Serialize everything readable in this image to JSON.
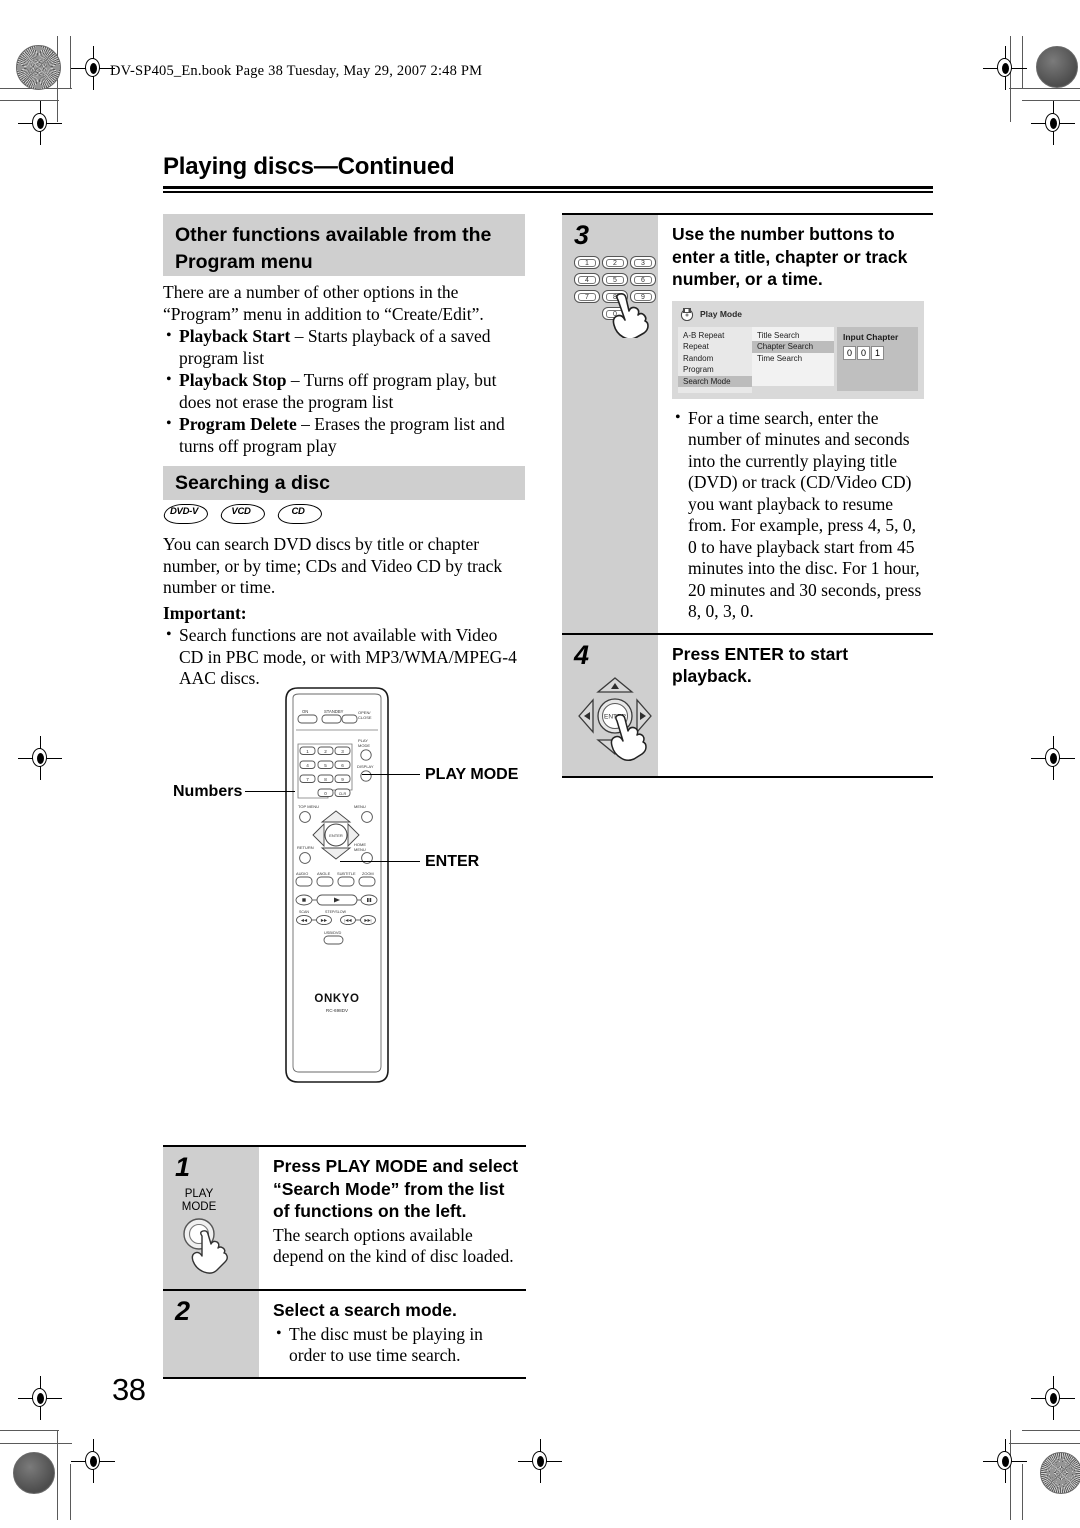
{
  "document": {
    "file_header": "DV-SP405_En.book  Page 38  Tuesday, May 29, 2007  2:48 PM",
    "page_number": "38",
    "running_head_title": "Playing discs",
    "running_head_continued": "—Continued"
  },
  "left_column": {
    "section1": {
      "banner_line1": "Other functions available from the",
      "banner_line2": "Program menu",
      "intro": "There are a number of other options in the “Program” menu in addition to “Create/Edit”.",
      "bullets": [
        {
          "term": "Playback Start",
          "dash": " – ",
          "text": "Starts playback of a saved program list"
        },
        {
          "term": "Playback Stop",
          "dash": " – ",
          "text": "Turns off program play, but does not erase the program list"
        },
        {
          "term": "Program Delete",
          "dash": " – ",
          "text": "Erases the program list and turns off program play"
        }
      ]
    },
    "section2": {
      "banner": "Searching a disc",
      "disc_badges": [
        "DVD-V",
        "VCD",
        "CD"
      ],
      "intro": "You can search DVD discs by title or chapter number, or by time; CDs and Video CD by track number or time.",
      "important_label": "Important:",
      "important_bullets": [
        "Search functions are not available with Video CD in PBC mode, or with MP3/WMA/MPEG-4 AAC discs."
      ]
    },
    "remote": {
      "callout_numbers": "Numbers",
      "callout_play_mode": "PLAY MODE",
      "callout_enter": "ENTER",
      "top_buttons": [
        "ON",
        "STANDBY",
        "OPEN/ CLOSE"
      ],
      "side_buttons": [
        "PLAY MODE",
        "DISPLAY"
      ],
      "number_keys": [
        "1",
        "2",
        "3",
        "4",
        "5",
        "6",
        "7",
        "8",
        "9",
        "0",
        "CLR"
      ],
      "menu_buttons": [
        "TOP MENU",
        "MENU",
        "RETURN",
        "HOME MENU"
      ],
      "function_buttons": [
        "AUDIO",
        "ANGLE",
        "SUBTITLE",
        "ZOOM"
      ],
      "transport_labels": [
        "SCAN",
        "STEP/SLOW"
      ],
      "usb_button": "USB/DVD",
      "brand": "ONKYO",
      "model": "RC-698DV",
      "enter_label": "ENTER"
    },
    "steps": [
      {
        "number": "1",
        "head": "Press PLAY MODE and select “Search Mode” from the list of functions on the left.",
        "sub": "The search options available depend on the kind of disc loaded.",
        "icon": "play-mode-button",
        "icon_label_line1": "PLAY",
        "icon_label_line2": "MODE"
      },
      {
        "number": "2",
        "head": "Select a search mode.",
        "bullets": [
          "The disc must be playing in order to use time search."
        ],
        "icon": "none"
      }
    ]
  },
  "right_column": {
    "steps": [
      {
        "number": "3",
        "head": "Use the number buttons to enter a title, chapter or track number, or a time.",
        "icon": "number-keypad",
        "keys": [
          "1",
          "2",
          "3",
          "4",
          "5",
          "6",
          "7",
          "8",
          "9",
          "0"
        ],
        "bullets": [
          "For a time search, enter the number of minutes and seconds into the currently playing title (DVD) or track (CD/Video CD) you want playback to resume from. For example, press 4, 5, 0, 0 to have playback start from 45 minutes into the disc. For 1 hour, 20 minutes and 30 seconds, press 8, 0, 3, 0."
        ]
      },
      {
        "number": "4",
        "head": "Press ENTER to start playback.",
        "icon": "d-pad-enter",
        "enter_label": "ENTER"
      }
    ],
    "osd": {
      "title": "Play Mode",
      "left_menu": [
        "A-B Repeat",
        "Repeat",
        "Random",
        "Program",
        "Search Mode"
      ],
      "left_selected": "Search Mode",
      "mid_menu": [
        "Title Search",
        "Chapter Search",
        "Time Search"
      ],
      "mid_selected": "Chapter Search",
      "right_caption": "Input Chapter",
      "right_digits": [
        "0",
        "0",
        "1"
      ]
    }
  },
  "colors": {
    "banner_grey": "#cfcfcf",
    "osd_bg": "#d9d9d9",
    "osd_panel_light": "#f2f2f2",
    "osd_panel_mid": "#e8e8e8",
    "osd_highlight": "#bcbcbc",
    "osd_panel_dark": "#bfbfbf"
  }
}
